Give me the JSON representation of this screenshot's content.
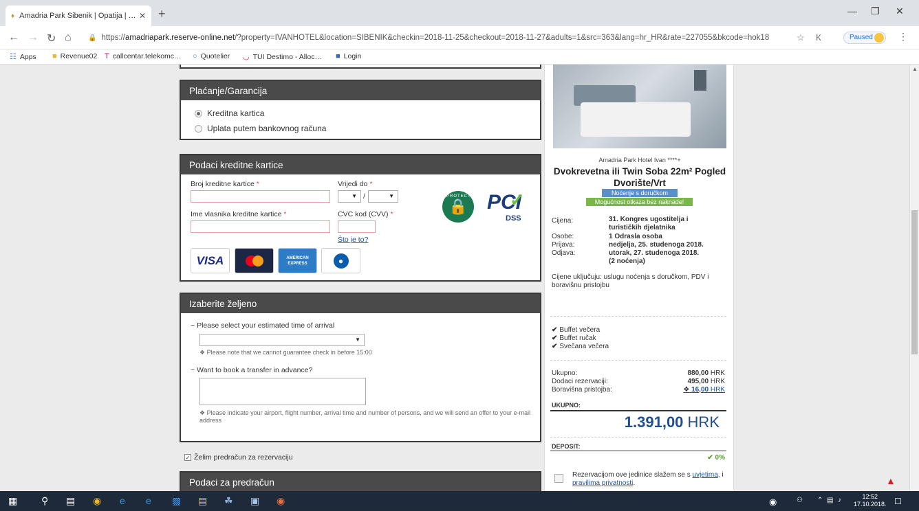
{
  "browser": {
    "tab_title": "Amadria Park Sibenik | Opatija | …",
    "url_scheme": "https://",
    "url_host": "amadriapark.reserve-online.net",
    "url_rest": "/?property=IVANHOTEL&location=SIBENIK&checkin=2018-11-25&checkout=2018-11-27&adults=1&src=363&lang=hr_HR&rate=227055&bkcode=hok18",
    "paused_label": "Paused",
    "bookmarks": [
      "Apps",
      "Revenue02",
      "callcentar.telekomc…",
      "Quotelier",
      "TUI Destimo - Alloc…",
      "Login"
    ]
  },
  "payment": {
    "title": "Plaćanje/Garancija",
    "option_card": "Kreditna kartica",
    "option_bank": "Uplata putem bankovnog računa"
  },
  "card_details": {
    "title": "Podaci kreditne kartice",
    "number_label": "Broj kreditne kartice",
    "expiry_label": "Vrijedi do",
    "expiry_sep": "/",
    "holder_label": "Ime vlasnika kreditne kartice",
    "cvc_label": "CVC kod (CVV)",
    "cvc_help": "Što je to?",
    "req_mark": "*",
    "brands": [
      "VISA",
      "mastercard",
      "AMERICAN EXPRESS",
      "Diners"
    ],
    "pci_label": "PCI",
    "dss_label": "DSS",
    "secure_label": "PROTECTED"
  },
  "choose": {
    "title": "Izaberite željeno",
    "arrival_question": "Please select your estimated time of arrival",
    "arrival_note": "Please note that we cannot guarantee check in before 15:00",
    "transfer_question": "Want to book a transfer in advance?",
    "transfer_note": "Please indicate your airport, flight number, arrival time and number of persons, and we will send an offer to your e-mail address"
  },
  "invoice": {
    "checkbox_label": "Želim predračun za rezervaciju",
    "panel_title": "Podaci za predračun"
  },
  "summary": {
    "hotel_name": "Amadria Park Hotel Ivan ****+",
    "room_title": "Dvokrevetna ili Twin Soba 22m² Pogled Dvorište/Vrt",
    "badge_board": "Noćenje s doručkom",
    "badge_cancel": "Mogućnost otkaza bez naknade!",
    "price_label": "Cijena:",
    "price_value": "31. Kongres ugostitelja i turističkih djelatnika",
    "persons_label": "Osobe:",
    "persons_value": "1 Odrasla osoba",
    "checkin_label": "Prijava:",
    "checkin_value": "nedjelja, 25. studenoga 2018.",
    "checkout_label": "Odjava:",
    "checkout_value": "utorak, 27. studenoga 2018.",
    "nights_value": "(2 noćenja)",
    "includes": "Cijene uključuju: uslugu noćenja s doručkom, PDV i boravišnu pristojbu",
    "extras": [
      "Buffet večera",
      "Buffet ručak",
      "Svečana večera"
    ],
    "total_label": "Ukupno:",
    "total_value": "880,00",
    "addons_label": "Dodaci rezervaciji:",
    "addons_value": "495,00",
    "tax_label": "Boravišna pristojba:",
    "tax_value": "16,00",
    "currency": "HRK",
    "grand_label": "UKUPNO:",
    "grand_value": "1.391,00",
    "deposit_label": "DEPOSIT:",
    "deposit_value": "0%",
    "terms_prefix": "Rezervacijom ove jedinice slažem se s",
    "terms_link1": "uvjetima",
    "terms_mid": ", i",
    "terms_link2": "pravilima privatnosti",
    "terms_end": "."
  },
  "taskbar": {
    "time": "12:52",
    "date": "17.10.2018."
  },
  "colors": {
    "panel_header": "#4a4a4a",
    "price_blue": "#1f4e8c",
    "badge_blue": "#5b8fc7",
    "badge_green": "#7ab648",
    "link_blue": "#1a4f9c"
  }
}
